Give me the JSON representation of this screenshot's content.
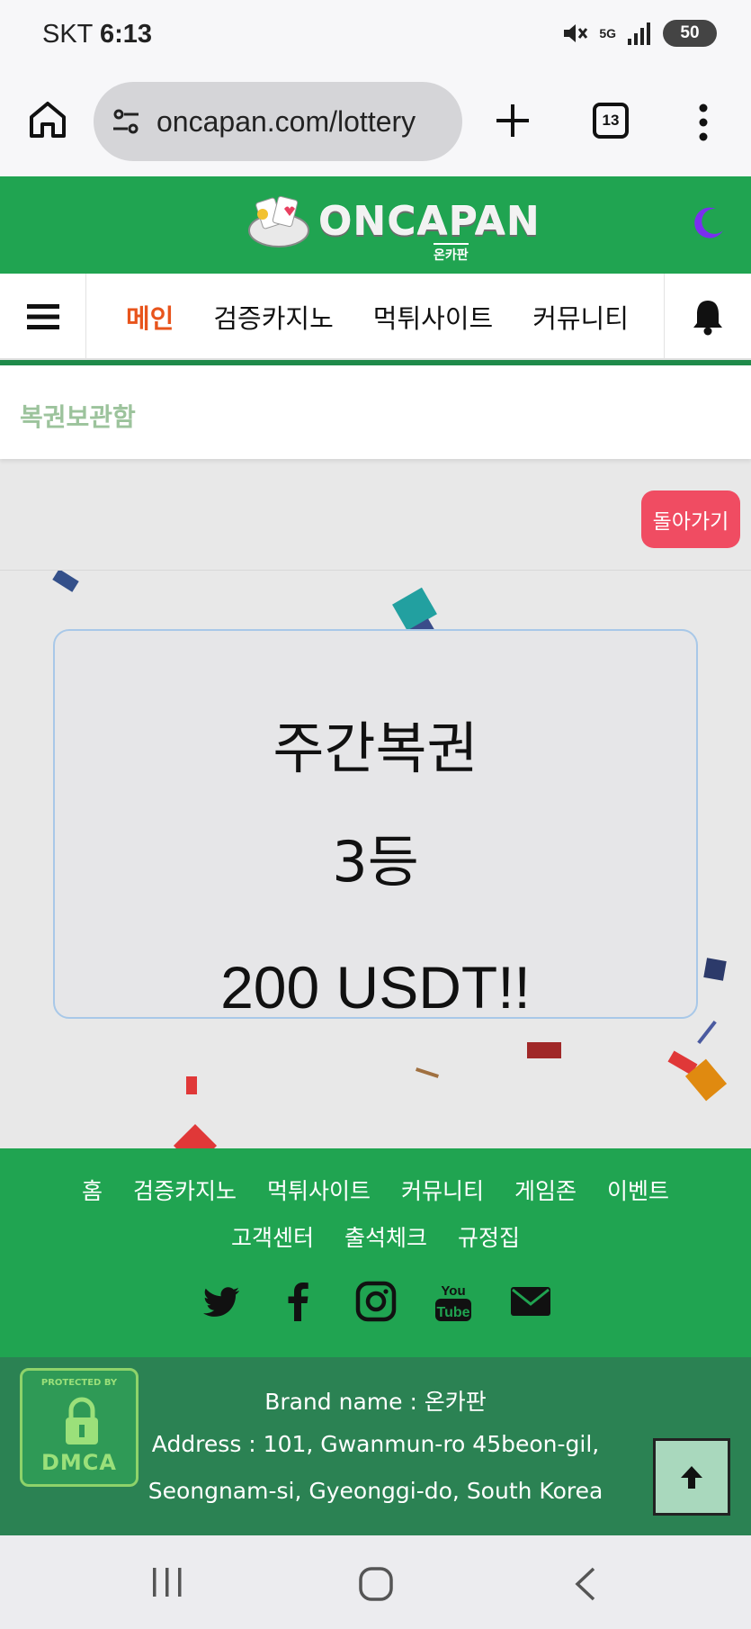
{
  "status": {
    "carrier": "SKT",
    "time": "6:13",
    "network": "5G",
    "battery": "50"
  },
  "browser": {
    "url": "oncapan.com/lottery",
    "tab_count": "13"
  },
  "site": {
    "logo_text": "ONCAPAN",
    "logo_sub": "온카판"
  },
  "nav": {
    "items": [
      "메인",
      "검증카지노",
      "먹튀사이트",
      "커뮤니티"
    ]
  },
  "breadcrumb": "복권보관함",
  "back_button": "돌아가기",
  "result": {
    "line1": "주간복권",
    "line2": "3등",
    "line3": "200 USDT!!"
  },
  "footer": {
    "links_row1": [
      "홈",
      "검증카지노",
      "먹튀사이트",
      "커뮤니티",
      "게임존",
      "이벤트"
    ],
    "links_row2": [
      "고객센터",
      "출석체크",
      "규정집"
    ],
    "social": [
      "twitter-icon",
      "facebook-icon",
      "instagram-icon",
      "youtube-icon",
      "mail-icon"
    ]
  },
  "info": {
    "badge_top": "PROTECTED BY",
    "badge_bottom": "DMCA",
    "brand": "Brand name : 온카판",
    "address1": "Address : 101, Gwanmun-ro 45beon-gil,",
    "address2": "Seongnam-si, Gyeonggi-do, South Korea"
  },
  "colors": {
    "header_green": "#20a451",
    "accent_orange": "#e8541c",
    "back_red": "#f04c62",
    "moon_purple": "#7a2ff0"
  }
}
